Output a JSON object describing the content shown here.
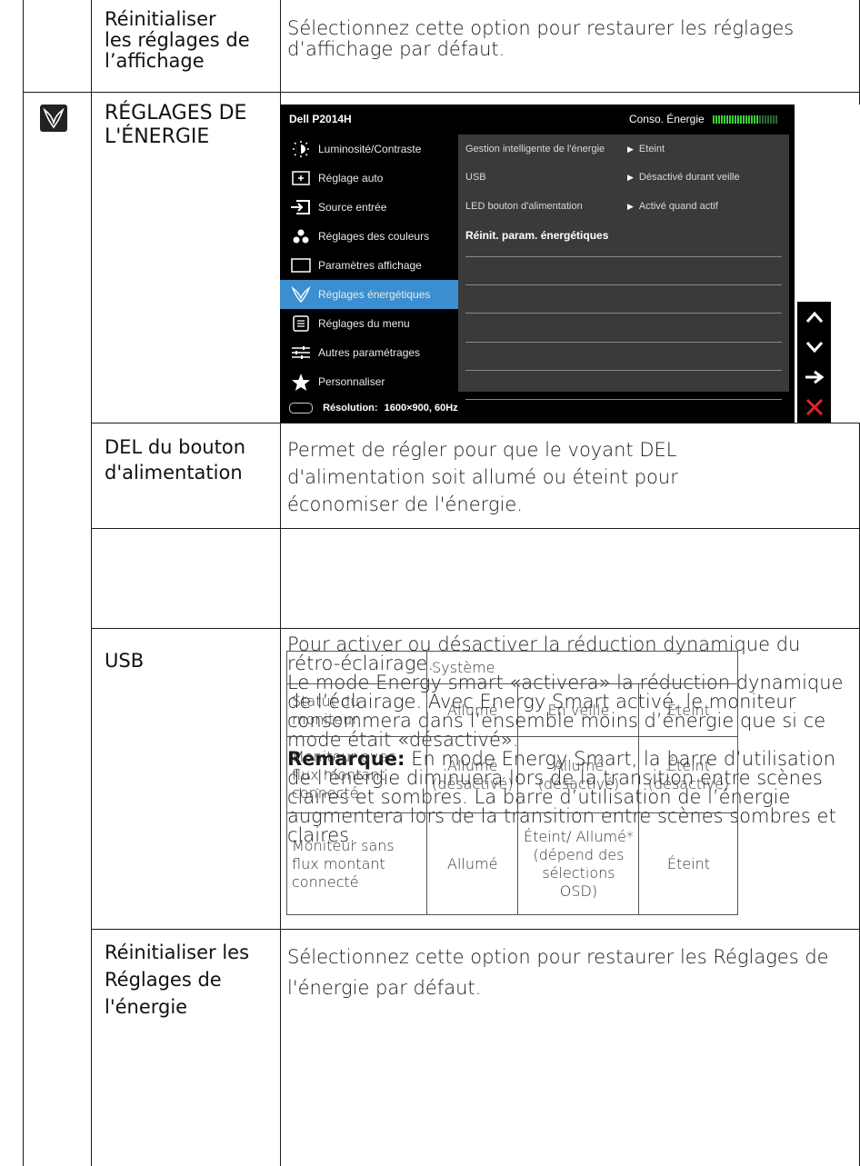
{
  "rows": {
    "reset_display": {
      "label": "Réinitialiser\nles réglages de\nl’affichage",
      "desc": "Sélectionnez cette option pour restaurer les réglages d’affichage par défaut."
    },
    "energy_settings": {
      "label": "RÉGLAGES DE\nL'ÉNERGIE",
      "icon": "energy-leaf-icon"
    },
    "power_led": {
      "label": "DEL du bouton\nd'alimentation",
      "desc": "Permet de régler pour que le voyant DEL d'alimentation soit allumé ou éteint pour économiser de l'énergie."
    },
    "energy_smart": {
      "desc1": "Pour activer ou désactiver la réduction dynamique du rétro-éclairage.",
      "desc2": "Le mode Energy smart «activera» la réduction dynamique de l’éclairage. Avec Energy Smart activé, le moniteur consommera dans l’ensemble moins d’énergie que si ce mode était «désactivé».",
      "note_label": "Remarque:",
      "note": " En mode Energy Smart, la barre d’utilisation de l’énergie diminuera lors de la transition entre scènes claires et sombres. La barre d’utilisation de l’énergie augmentera lors de la transition entre scènes sombres et claires."
    },
    "usb": {
      "label": "USB"
    },
    "reset_energy": {
      "label": "Réinitialiser les\nRéglages de\nl'énergie",
      "desc": "Sélectionnez cette option pour restaurer les Réglages de l'énergie par défaut."
    }
  },
  "osd": {
    "model": "Dell P2014H",
    "energy_label": "Conso. Énergie",
    "energy_meter_level": 0.7,
    "menu": [
      {
        "label": "Luminosité/Contraste",
        "icon": "brightness-icon"
      },
      {
        "label": "Réglage auto",
        "icon": "auto-adjust-icon"
      },
      {
        "label": "Source entrée",
        "icon": "input-source-icon"
      },
      {
        "label": "Réglages des couleurs",
        "icon": "color-settings-icon"
      },
      {
        "label": "Paramètres affichage",
        "icon": "display-settings-icon"
      },
      {
        "label": "Réglages énergétiques",
        "icon": "energy-leaf-icon",
        "selected": true
      },
      {
        "label": "Réglages du menu",
        "icon": "menu-settings-icon"
      },
      {
        "label": "Autres paramétrages",
        "icon": "other-settings-icon"
      },
      {
        "label": "Personnaliser",
        "icon": "star-icon"
      }
    ],
    "options": [
      {
        "name": "Gestion intelligente de l'énergie",
        "value": "Eteint"
      },
      {
        "name": "USB",
        "value": "Désactivé durant veille"
      },
      {
        "name": "LED bouton d'alimentation",
        "value": "Activé quand actif"
      },
      {
        "name": "Réinit. param. énergétiques",
        "value": ""
      }
    ],
    "resolution_label": "Résolution:",
    "resolution_value": "1600×900, 60Hz",
    "nav_buttons": [
      "up-arrow-icon",
      "down-arrow-icon",
      "right-arrow-icon",
      "close-icon"
    ]
  },
  "usb_table": {
    "header": "Système",
    "rows": [
      {
        "label": "Statut du moniteur",
        "cells": [
          "Allumé",
          "En veille",
          "Éteint"
        ]
      },
      {
        "label": "Moniteur avec flux montant connecté",
        "cells": [
          "Allumé (désactivé)",
          "Allumé (désactivé)",
          "Éteint (désactivé)"
        ]
      },
      {
        "label": "Moniteur sans flux montant connecté",
        "cells": [
          "Allumé",
          "Éteint/ Allumé*(dépend des sélections OSD)",
          "Éteint"
        ]
      }
    ]
  },
  "colors": {
    "osd_highlight": "#3b8fd0",
    "meter_green": "#3ad13a",
    "close_red": "#e0242a"
  }
}
